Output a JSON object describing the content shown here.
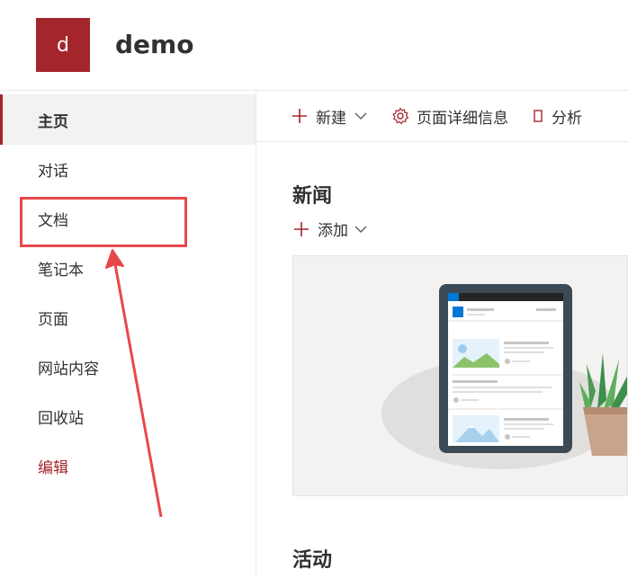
{
  "site": {
    "logo_letter": "d",
    "title": "demo",
    "accent": "#a4262c"
  },
  "sidebar": {
    "items": [
      {
        "label": "主页",
        "active": true
      },
      {
        "label": "对话"
      },
      {
        "label": "文档",
        "highlighted": true
      },
      {
        "label": "笔记本"
      },
      {
        "label": "页面"
      },
      {
        "label": "网站内容"
      },
      {
        "label": "回收站"
      },
      {
        "label": "编辑",
        "style": "accent"
      }
    ]
  },
  "commandbar": {
    "new_label": "新建",
    "page_details_label": "页面详细信息",
    "analytics_label": "分析",
    "icons": [
      "plus-icon",
      "chevron-down-icon",
      "gear-icon",
      "analytics-icon"
    ]
  },
  "news": {
    "title": "新闻",
    "add_label": "添加"
  },
  "activity": {
    "title": "活动"
  },
  "annotation": {
    "box_color": "#e8474a",
    "arrow_color": "#e8474a"
  }
}
